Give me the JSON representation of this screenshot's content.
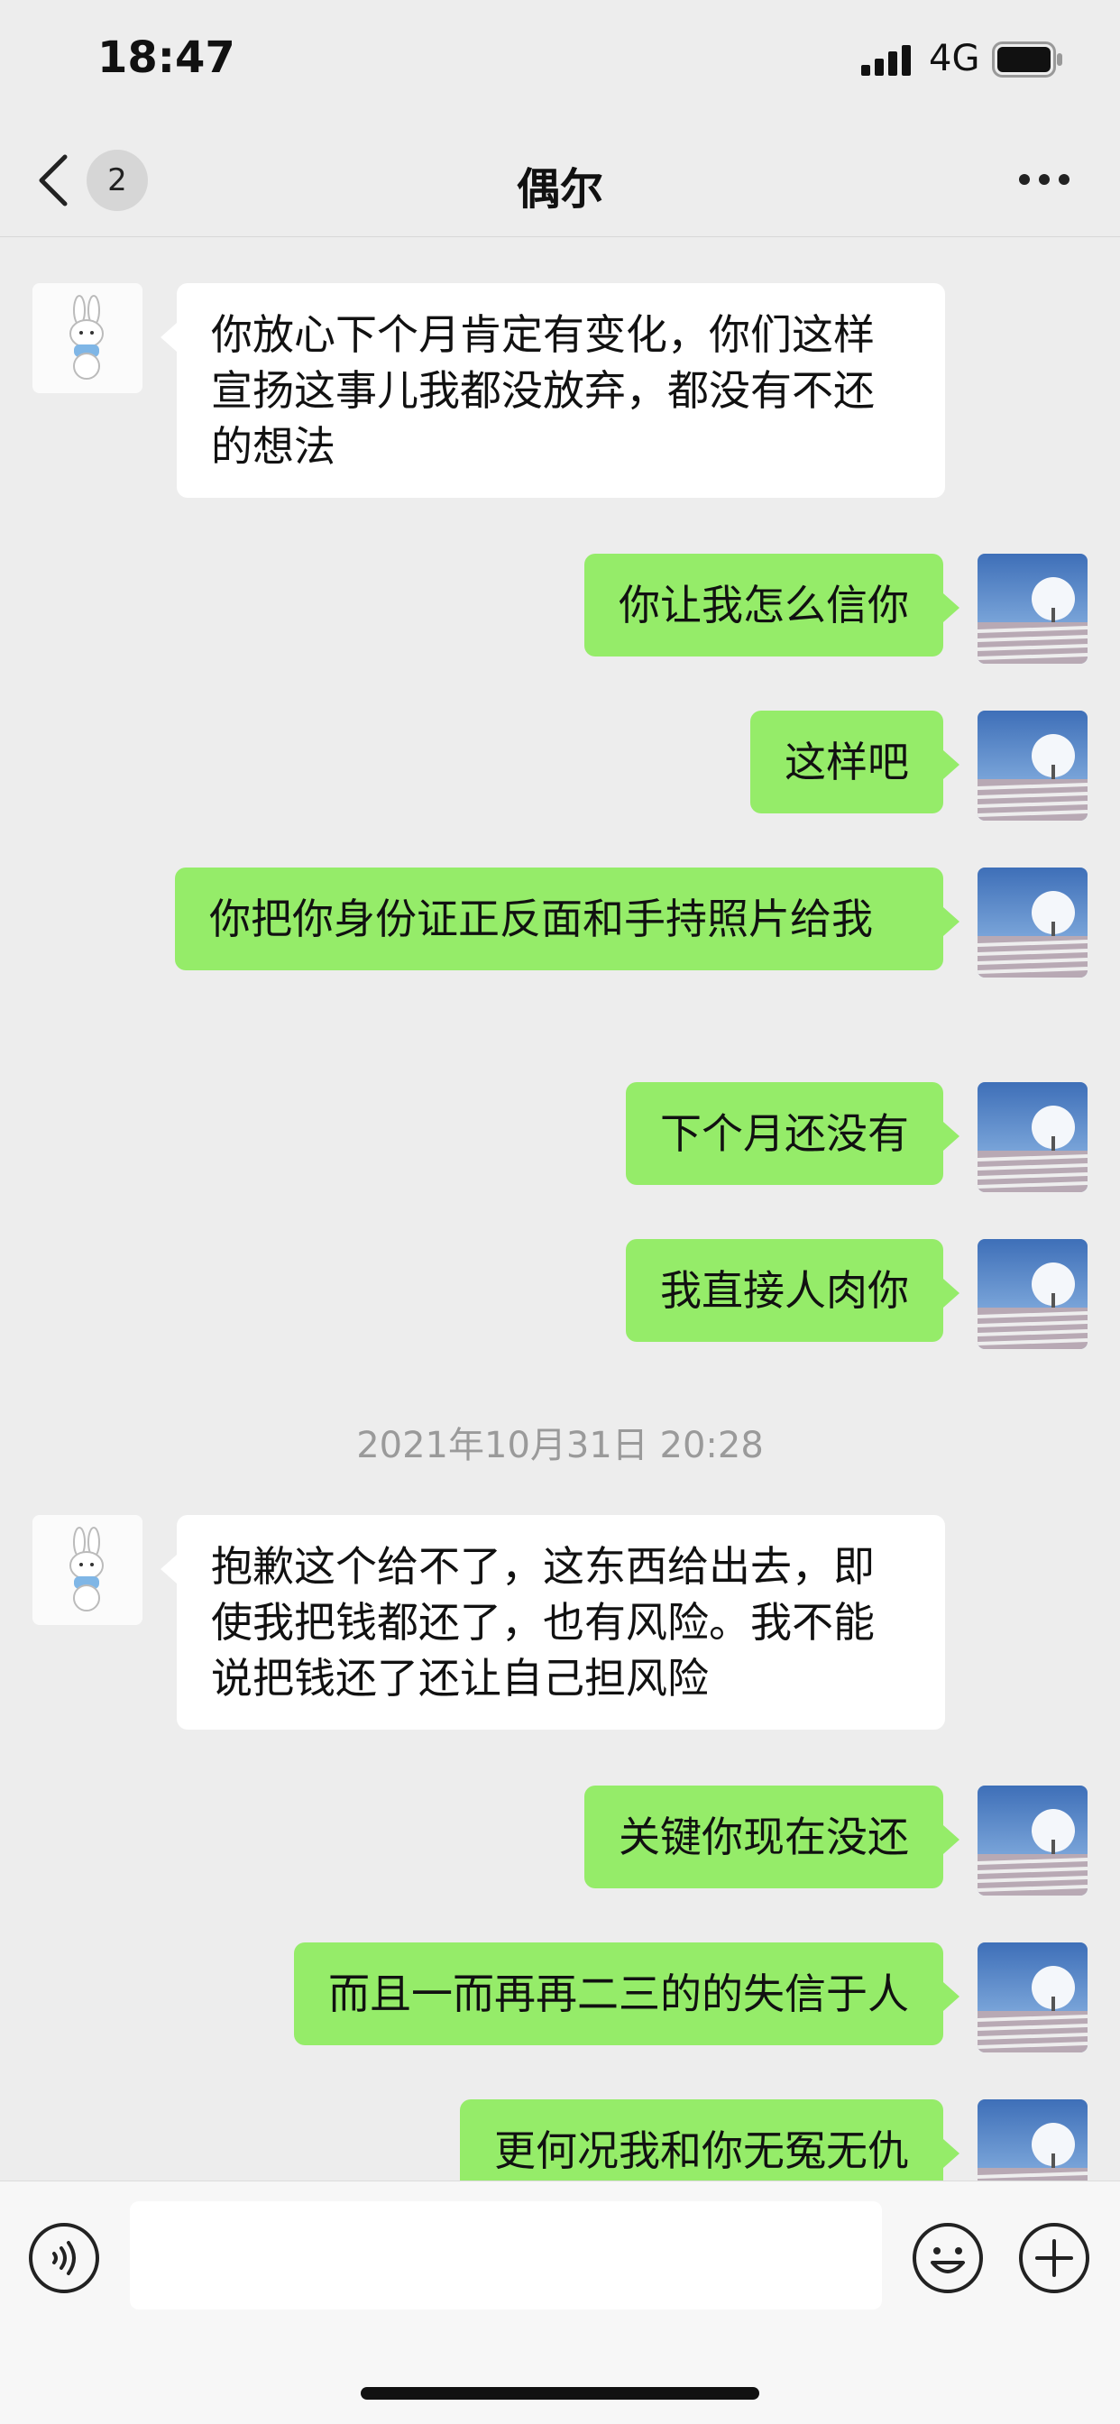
{
  "status_bar": {
    "time": "18:47",
    "network": "4G"
  },
  "nav": {
    "unread_count": "2",
    "title": "偶尔",
    "back_icon": "chevron-left-icon",
    "more_icon": "more-horizontal-icon"
  },
  "messages": [
    {
      "side": "left",
      "text": "你放心下个月肯定有变化，你们这样宣扬这事儿我都没放弃，都没有不还的想法"
    },
    {
      "side": "right",
      "text": "你让我怎么信你"
    },
    {
      "side": "right",
      "text": "这样吧"
    },
    {
      "side": "right",
      "text": "你把你身份证正反面和手持照片给我"
    },
    {
      "side": "right",
      "text": "下个月还没有"
    },
    {
      "side": "right",
      "text": "我直接人肉你"
    },
    {
      "side": "left",
      "text": "抱歉这个给不了，这东西给出去，即使我把钱都还了，也有风险。我不能说把钱还了还让自己担风险"
    },
    {
      "side": "right",
      "text": "关键你现在没还"
    },
    {
      "side": "right",
      "text": "而且一而再再二三的的失信于人"
    },
    {
      "side": "right",
      "text": "更何况我和你无冤无仇"
    }
  ],
  "timestamp": "2021年10月31日 20:28",
  "input_bar": {
    "placeholder": "",
    "voice_icon": "voice-icon",
    "emoji_icon": "emoji-icon",
    "add_icon": "plus-circle-icon"
  },
  "colors": {
    "bubble_sent": "#95ec69",
    "bubble_received": "#ffffff",
    "background": "#ededed"
  }
}
